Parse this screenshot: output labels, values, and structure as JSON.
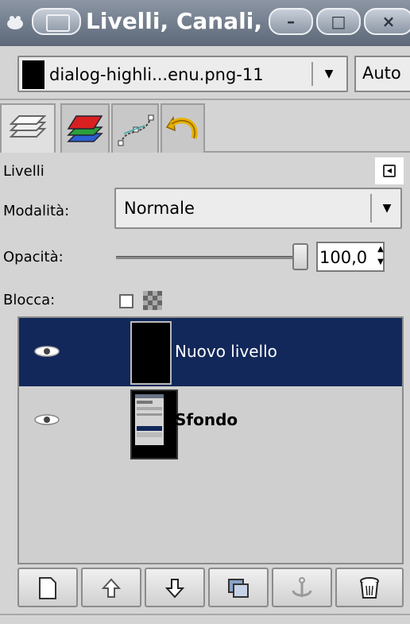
{
  "window": {
    "title": "Livelli, Canali, T",
    "buttons": {
      "minimize": "–",
      "maximize": "□",
      "close": "×"
    }
  },
  "image_selector": {
    "value": "dialog-highli...enu.png-11",
    "auto_label": "Auto"
  },
  "tabs": [
    {
      "name": "layers",
      "icon": "layers-icon"
    },
    {
      "name": "channels",
      "icon": "channels-icon"
    },
    {
      "name": "paths",
      "icon": "paths-icon"
    },
    {
      "name": "undo",
      "icon": "undo-history-icon"
    }
  ],
  "panel": {
    "title": "Livelli",
    "mode_label": "Modalità:",
    "mode_value": "Normale",
    "opacity_label": "Opacità:",
    "opacity_value": "100,0",
    "opacity_fraction": 1.0,
    "lock_label": "Blocca:"
  },
  "layers": [
    {
      "name": "Nuovo livello",
      "visible": true,
      "selected": true,
      "bold": false
    },
    {
      "name": "Sfondo",
      "visible": true,
      "selected": false,
      "bold": true
    }
  ],
  "toolbar": [
    {
      "name": "new-layer",
      "icon": "new-document-icon"
    },
    {
      "name": "raise-layer",
      "icon": "arrow-up-icon"
    },
    {
      "name": "lower-layer",
      "icon": "arrow-down-icon"
    },
    {
      "name": "duplicate-layer",
      "icon": "duplicate-icon"
    },
    {
      "name": "anchor-layer",
      "icon": "anchor-icon"
    },
    {
      "name": "delete-layer",
      "icon": "trash-icon"
    }
  ],
  "colors": {
    "selection": "#12285a",
    "title_bar": "#5c6878"
  }
}
